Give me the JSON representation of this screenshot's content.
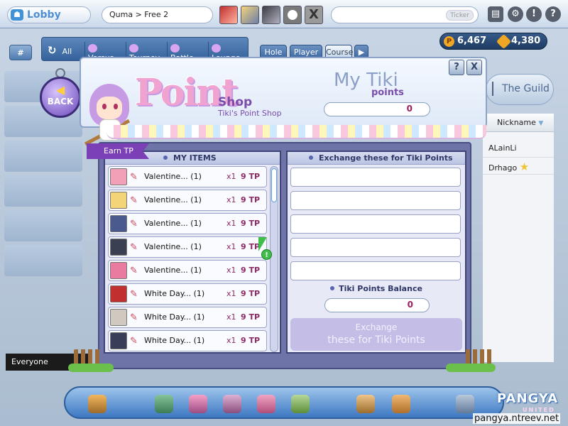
{
  "topbar": {
    "lobby_label": "Lobby",
    "breadcrumb": "Quma > Free 2",
    "ticker_label": "Ticker",
    "party_slots": [
      "character-red",
      "character-blonde",
      "character-dark",
      "golf-ball",
      "empty-slot"
    ],
    "close_glyph": "X",
    "icons": [
      "backpack-icon",
      "settings-icon",
      "alert-icon",
      "help-icon"
    ]
  },
  "filterbar": {
    "hash_label": "#",
    "tabs": [
      {
        "label": "All",
        "icon": "refresh-icon"
      },
      {
        "label": "Versus",
        "icon": "versus-icon"
      },
      {
        "label": "Tourney",
        "icon": "tourney-icon"
      },
      {
        "label": "Battle",
        "icon": "battle-icon"
      },
      {
        "label": "Lounge",
        "icon": "lounge-icon"
      }
    ],
    "sort_buttons": [
      "Hole",
      "Player",
      "Course",
      "▶"
    ]
  },
  "currency": {
    "pang": "6,467",
    "cookie": "4,380"
  },
  "right_panel": {
    "guild_label": "The Guild",
    "nickname_header": "Nickname",
    "players": [
      {
        "name": "ALainLi",
        "badge": ""
      },
      {
        "name": "Drhago",
        "badge": "★"
      }
    ]
  },
  "chat": {
    "channel": "Everyone"
  },
  "shop": {
    "back_label": "BACK",
    "logo_text": "Point",
    "title": "Shop",
    "subtitle": "Tiki's Point Shop",
    "my_tiki_title": "My Tiki",
    "my_tiki_sub": "points",
    "my_tiki_value": "0",
    "help_glyph": "?",
    "close_glyph": "X",
    "earn_tab": "Earn TP",
    "my_items_header": "MY ITEMS",
    "exchange_header": "Exchange these for Tiki Points",
    "items": [
      {
        "name": "Valentine... (1)",
        "qty": "x1",
        "tp": "9 TP",
        "color": "#f2a0b8"
      },
      {
        "name": "Valentine... (1)",
        "qty": "x1",
        "tp": "9 TP",
        "color": "#f4d479"
      },
      {
        "name": "Valentine... (1)",
        "qty": "x1",
        "tp": "9 TP",
        "color": "#4b5a8e"
      },
      {
        "name": "Valentine... (1)",
        "qty": "x1",
        "tp": "9 TP",
        "color": "#3b3f52"
      },
      {
        "name": "Valentine... (1)",
        "qty": "x1",
        "tp": "9 TP",
        "color": "#e97aa0"
      },
      {
        "name": "White Day... (1)",
        "qty": "x1",
        "tp": "9 TP",
        "color": "#c12f2f"
      },
      {
        "name": "White Day... (1)",
        "qty": "x1",
        "tp": "9 TP",
        "color": "#d0c9c0"
      },
      {
        "name": "White Day... (1)",
        "qty": "x1",
        "tp": "9 TP",
        "color": "#3a3d58"
      }
    ],
    "balance_label": "Tiki Points Balance",
    "balance_value": "0",
    "exchange_button": {
      "line1": "Exchange",
      "line2": "these for Tiki Points"
    }
  },
  "bottombar": {
    "icons": [
      "music-icon",
      "shop-scale-icon",
      "gift-icon",
      "locker-icon",
      "house-icon",
      "puzzle-icon",
      "home-arrow-icon",
      "swap-icon",
      "options-icon"
    ]
  },
  "branding": {
    "logo": "PANGYA",
    "logo_sub": "UNITED",
    "url": "pangya.ntreev.net"
  }
}
